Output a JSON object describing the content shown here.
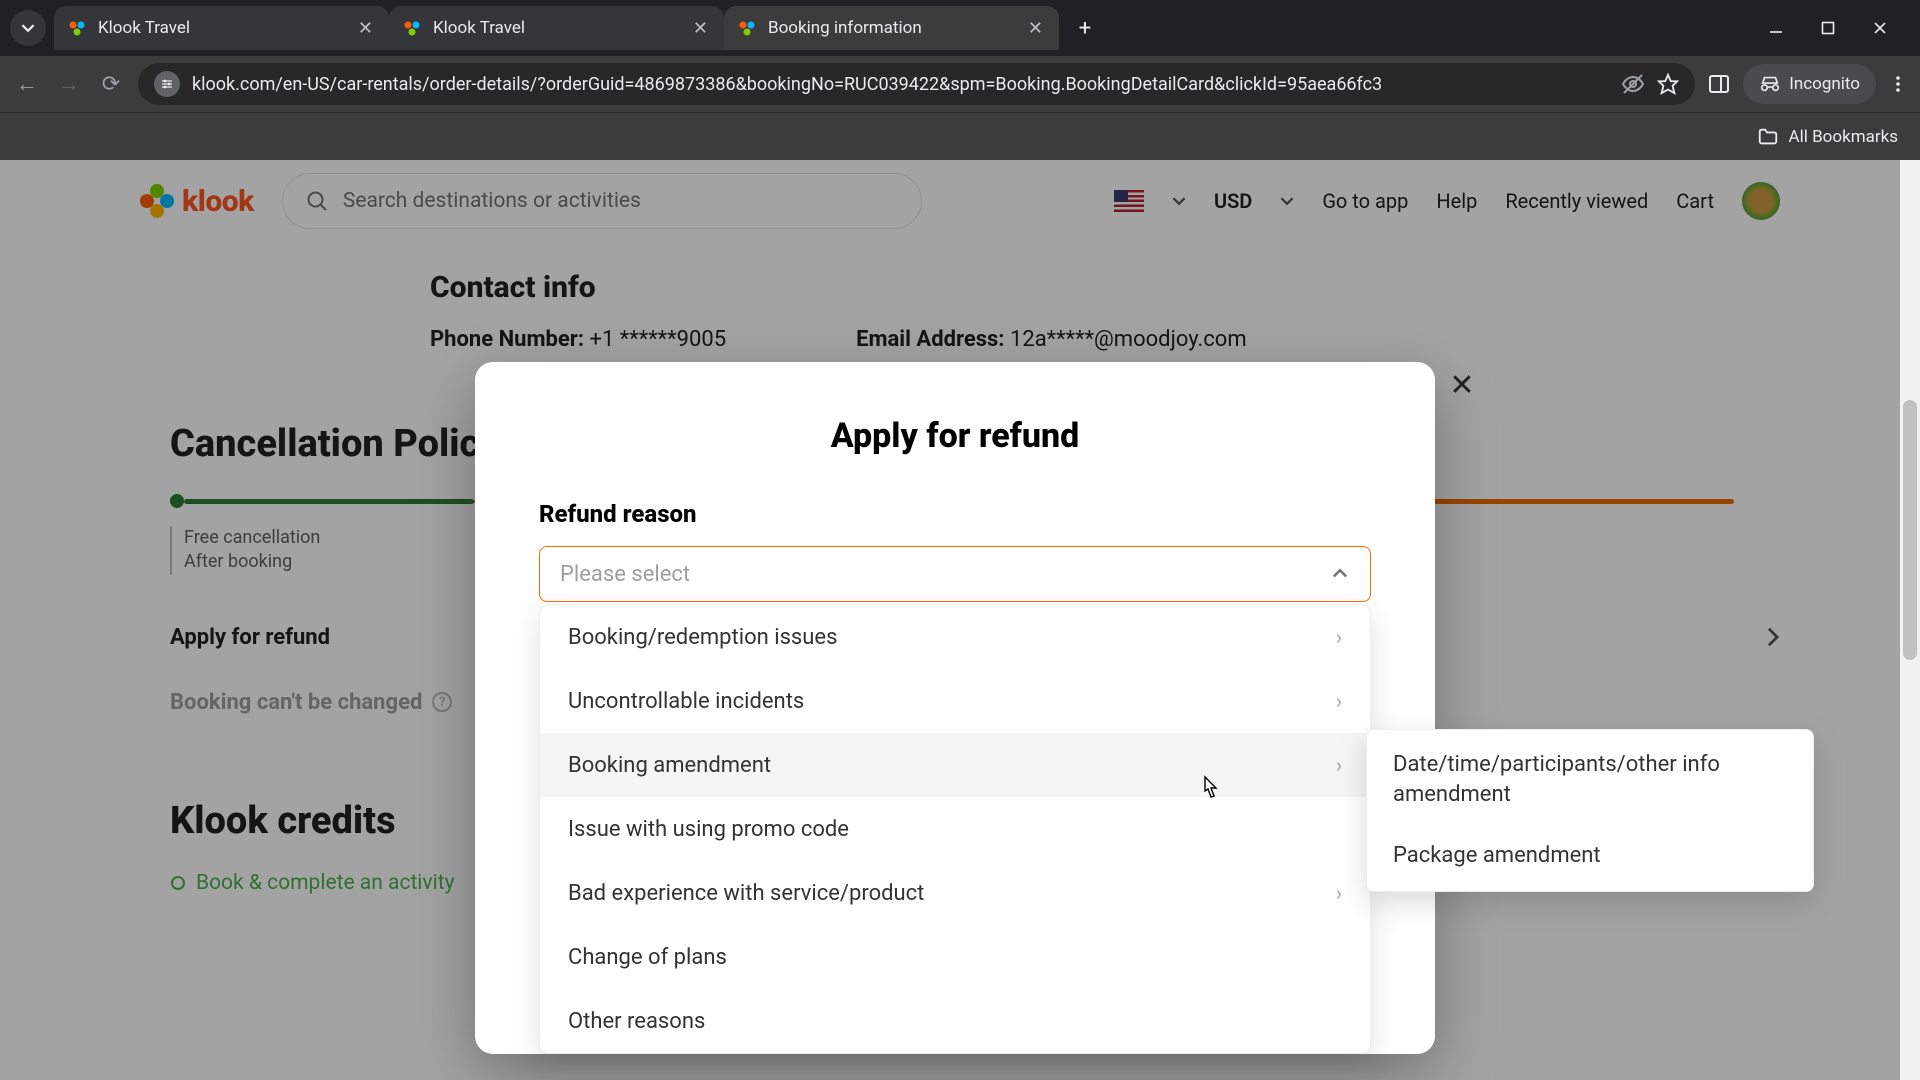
{
  "browser": {
    "tabs": [
      {
        "title": "Klook Travel"
      },
      {
        "title": "Klook Travel"
      },
      {
        "title": "Booking information"
      }
    ],
    "url": "klook.com/en-US/car-rentals/order-details/?orderGuid=4869873386&bookingNo=RUC039422&spm=Booking.BookingDetailCard&clickId=95aea66fc3",
    "incognito_label": "Incognito",
    "bookmarks_label": "All Bookmarks"
  },
  "header": {
    "logo_text": "klook",
    "search_placeholder": "Search destinations or activities",
    "currency": "USD",
    "links": {
      "go_to_app": "Go to app",
      "help": "Help",
      "recent": "Recently viewed",
      "cart": "Cart"
    }
  },
  "page": {
    "contact_title": "Contact info",
    "phone_label": "Phone Number:",
    "phone_value": "+1 ******9005",
    "email_label": "Email Address:",
    "email_value": "12a*****@moodjoy.com",
    "cancel_title": "Cancellation Polic",
    "step1a": "Free cancellation",
    "step1b": "After booking",
    "apply_link": "Apply for refund",
    "cant_change": "Booking can't be changed",
    "credits_title": "Klook credits",
    "bullet1": "Book & complete an activity"
  },
  "modal": {
    "title": "Apply for refund",
    "label": "Refund reason",
    "placeholder": "Please select",
    "options": [
      {
        "label": "Booking/redemption issues",
        "has_children": true
      },
      {
        "label": "Uncontrollable incidents",
        "has_children": true
      },
      {
        "label": "Booking amendment",
        "has_children": true,
        "hover": true
      },
      {
        "label": "Issue with using promo code",
        "has_children": false
      },
      {
        "label": "Bad experience with service/product",
        "has_children": true
      },
      {
        "label": "Change of plans",
        "has_children": false
      },
      {
        "label": "Other reasons",
        "has_children": false
      }
    ],
    "submenu": [
      "Date/time/participants/other info amendment",
      "Package amendment"
    ]
  }
}
